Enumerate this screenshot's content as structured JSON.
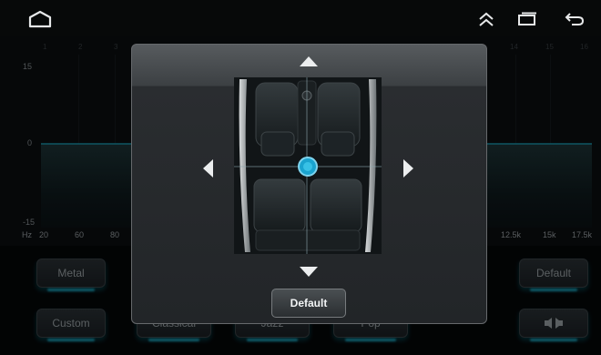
{
  "status_bar": {
    "home_icon": "home-icon",
    "collapse_icon": "double-chevron-up-icon",
    "recents_icon": "recents-icon",
    "back_icon": "back-icon"
  },
  "equalizer": {
    "band_numbers": [
      "1",
      "2",
      "3",
      "14",
      "15",
      "16"
    ],
    "y_labels": [
      "15",
      "0",
      "-15"
    ],
    "hz_label": "Hz",
    "freq_labels_left": [
      "20",
      "60",
      "80"
    ],
    "freq_labels_right": [
      "12.5k",
      "15k",
      "17.5k"
    ],
    "accent_color": "#1fb5d0"
  },
  "presets": {
    "metal": "Metal",
    "custom": "Custom",
    "classical": "Classical",
    "jazz": "Jazz",
    "pop": "Pop",
    "default": "Default",
    "balance_icon": "speaker-balance-icon"
  },
  "fader_dialog": {
    "up_icon": "triangle-up-icon",
    "down_icon": "triangle-down-icon",
    "left_icon": "triangle-left-icon",
    "right_icon": "triangle-right-icon",
    "default_label": "Default",
    "knob_color": "#1aa3cf"
  }
}
